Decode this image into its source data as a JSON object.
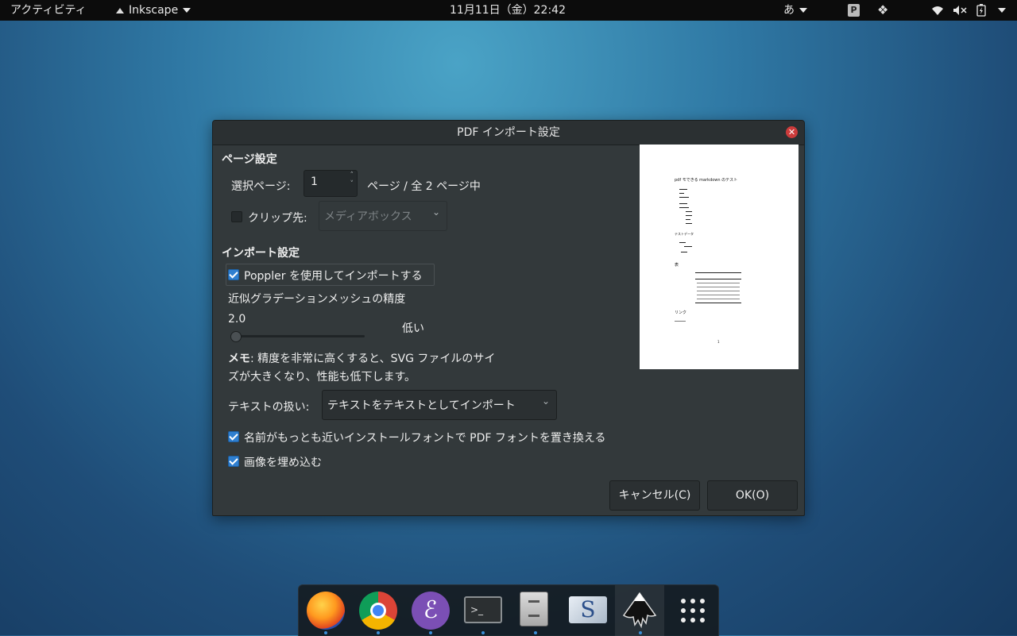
{
  "topbar": {
    "activities": "アクティビティ",
    "app_menu": "Inkscape",
    "clock": "11月11日（金）22:42",
    "input_method": "あ"
  },
  "dialog": {
    "title": "PDF インポート設定",
    "page_section": {
      "title": "ページ設定",
      "select_page_label": "選択ページ:",
      "select_page_value": "1",
      "page_of_total": "ページ / 全 2 ページ中",
      "clip_label": "クリップ先:",
      "clip_checked": false,
      "clip_option": "メディアボックス"
    },
    "import_section": {
      "title": "インポート設定",
      "poppler_label": "Poppler を使用してインポートする",
      "poppler_checked": true,
      "mesh_precision_label": "近似グラデーションメッシュの精度",
      "mesh_precision_value": "2.0",
      "mesh_precision_level": "低い",
      "note_bold": "メモ",
      "note_line1": ": 精度を非常に高くすると、SVG ファイルのサイ",
      "note_line2": "ズが大きくなり、性能も低下します。",
      "text_handling_label": "テキストの扱い:",
      "text_handling_value": "テキストをテキストとしてインポート",
      "replace_fonts_label": "名前がもっとも近いインストールフォントで PDF フォントを置き換える",
      "replace_fonts_checked": true,
      "embed_images_label": "画像を埋め込む",
      "embed_images_checked": true
    },
    "buttons": {
      "cancel": "キャンセル(C)",
      "ok": "OK(O)"
    },
    "preview": {
      "heading": "pdf モできる markdown のテスト",
      "section2": "テストデータ",
      "section3": "表",
      "section4": "リンク",
      "page_number": "1"
    }
  },
  "dock": {
    "apps": [
      "firefox-icon",
      "chrome-icon",
      "emacs-icon",
      "terminal-icon",
      "files-icon",
      "scribus-icon",
      "inkscape-icon",
      "app-grid-icon"
    ]
  }
}
